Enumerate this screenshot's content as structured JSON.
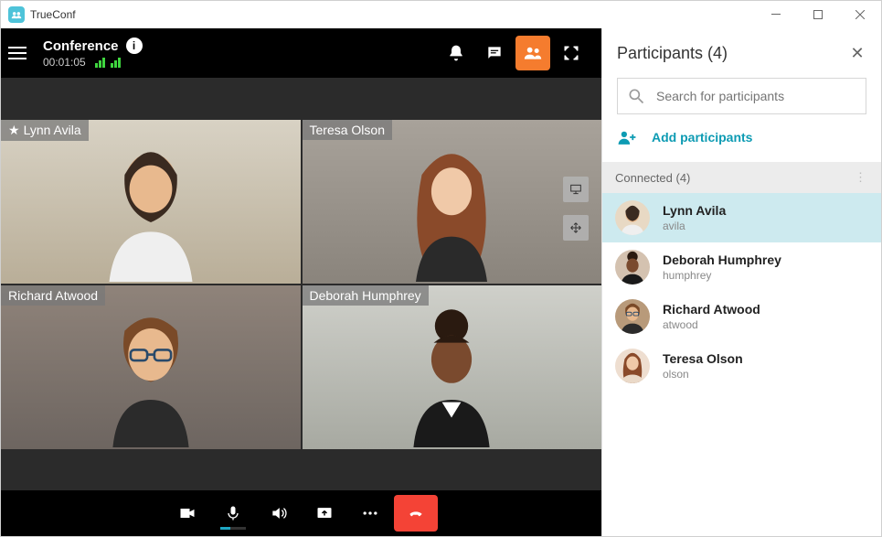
{
  "titlebar": {
    "app_name": "TrueConf"
  },
  "topbar": {
    "conference_label": "Conference",
    "timer": "00:01:05"
  },
  "videos": [
    {
      "name": "Lynn Avila",
      "owner": true
    },
    {
      "name": "Teresa Olson",
      "owner": false
    },
    {
      "name": "Richard Atwood",
      "owner": false
    },
    {
      "name": "Deborah Humphrey",
      "owner": false
    }
  ],
  "panel": {
    "title": "Participants (4)",
    "search_placeholder": "Search for participants",
    "add_label": "Add participants",
    "connected_label": "Connected (4)",
    "list": [
      {
        "name": "Lynn Avila",
        "id": "avila",
        "selected": true,
        "owner": true
      },
      {
        "name": "Deborah Humphrey",
        "id": "humphrey",
        "selected": false,
        "owner": false
      },
      {
        "name": "Richard Atwood",
        "id": "atwood",
        "selected": false,
        "owner": false
      },
      {
        "name": "Teresa Olson",
        "id": "olson",
        "selected": false,
        "owner": false
      }
    ]
  }
}
